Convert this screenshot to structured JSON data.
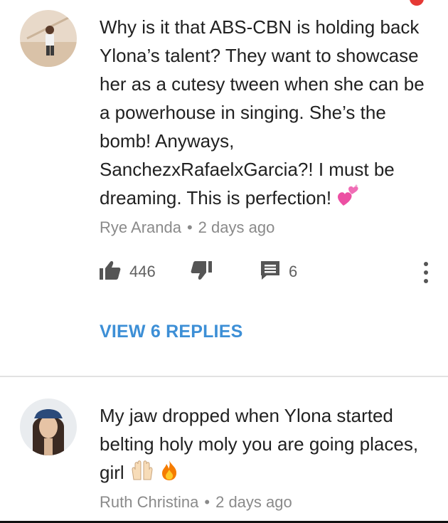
{
  "comments": [
    {
      "text": "Why is it that ABS-CBN is holding back Ylona’s talent? They want to showcase her as a cutesy tween when she can be a powerhouse in singing. She’s the bomb! Anyways, SanchezxRafaelxGarcia?! I must be dreaming. This is perfection!",
      "emoji": "two-hearts",
      "author": "Rye Aranda",
      "time": "2 days ago",
      "likes": "446",
      "reply_count": "6",
      "view_replies": "VIEW 6 REPLIES"
    },
    {
      "text": "My jaw dropped when Ylona started belting holy moly you are going places, girl",
      "emoji": [
        "raising-hands",
        "fire"
      ],
      "author": "Ruth Christina",
      "time": "2 days ago"
    }
  ],
  "colors": {
    "link": "#3d8fd6",
    "meta": "#8a8a8a",
    "icon": "#555555"
  }
}
